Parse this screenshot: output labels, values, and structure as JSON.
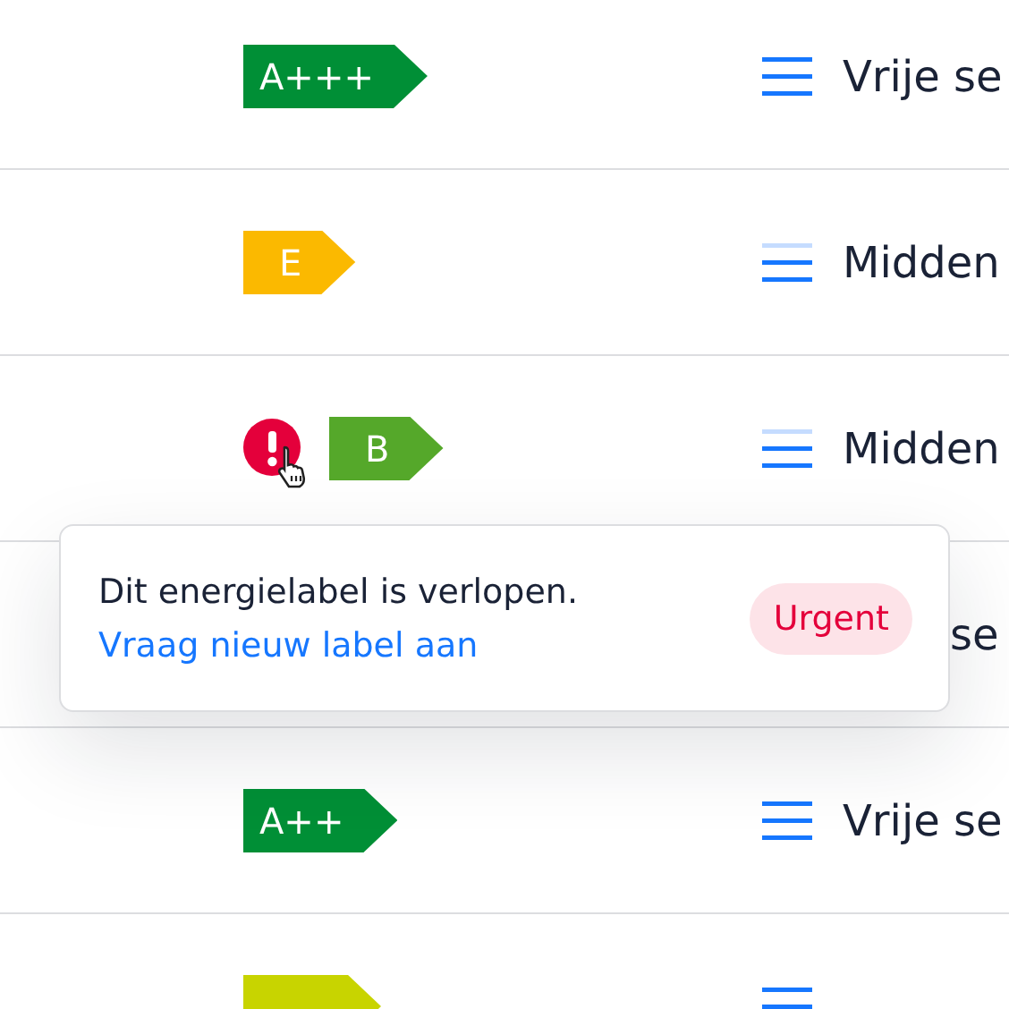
{
  "rows": [
    {
      "kind": "full",
      "label": {
        "text": "A+++",
        "color": "#008f36"
      },
      "warning": false,
      "menu_top_faded": false,
      "text": "Vrije se"
    },
    {
      "kind": "full",
      "label": {
        "text": "E",
        "color": "#fbb900"
      },
      "warning": false,
      "menu_top_faded": true,
      "text": "Midden"
    },
    {
      "kind": "full",
      "label": {
        "text": "B",
        "color": "#55a82a"
      },
      "warning": true,
      "menu_top_faded": true,
      "text": "Midden"
    },
    {
      "kind": "covered",
      "text": "se"
    },
    {
      "kind": "full",
      "label": {
        "text": "A++",
        "color": "#008f36"
      },
      "warning": false,
      "menu_top_faded": false,
      "text": "Vrije se"
    },
    {
      "kind": "cut",
      "label": {
        "color": "#c8d400"
      },
      "menu_top_faded": false
    }
  ],
  "tooltip": {
    "message": "Dit energielabel is verlopen.",
    "link": "Vraag nieuw label aan",
    "badge": "Urgent"
  }
}
